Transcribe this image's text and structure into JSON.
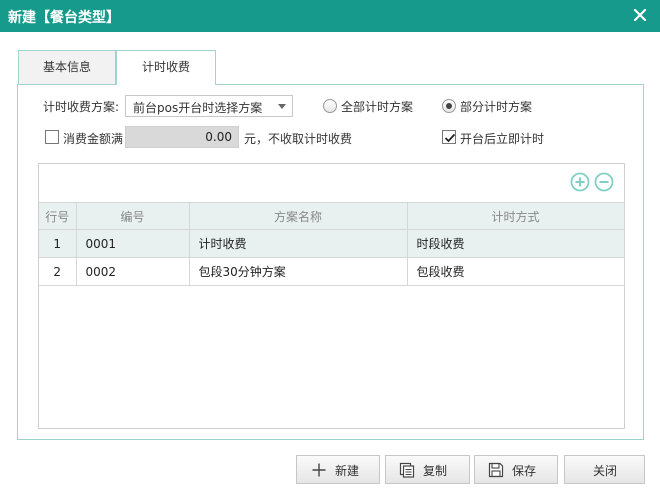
{
  "window": {
    "title": "新建【餐台类型】"
  },
  "tabs": [
    {
      "label": "基本信息",
      "active": false
    },
    {
      "label": "计时收费",
      "active": true
    }
  ],
  "form": {
    "scheme_label": "计时收费方案:",
    "scheme_value": "前台pos开台时选择方案",
    "radio_all_label": "全部计时方案",
    "radio_partial_label": "部分计时方案",
    "selected_radio": "部分计时方案",
    "min_spend_label": "消费金额满",
    "min_spend_checked": false,
    "min_spend_value": "0.00",
    "min_spend_suffix": "元，不收取计时收费",
    "start_timing_label": "开台后立即计时",
    "start_timing_checked": true
  },
  "grid": {
    "add_icon": "plus-circle-icon",
    "remove_icon": "minus-circle-icon",
    "columns": [
      "行号",
      "编号",
      "方案名称",
      "计时方式"
    ],
    "rows": [
      [
        "1",
        "0001",
        "计时收费",
        "时段收费"
      ],
      [
        "2",
        "0002",
        "包段30分钟方案",
        "包段收费"
      ]
    ],
    "selected_row": 1
  },
  "footer": {
    "new_label": "新建",
    "copy_label": "复制",
    "save_label": "保存",
    "close_label": "关闭"
  },
  "colors": {
    "accent": "#159a8c",
    "border": "#9ed4cd",
    "icon": "#7fcfc6"
  }
}
